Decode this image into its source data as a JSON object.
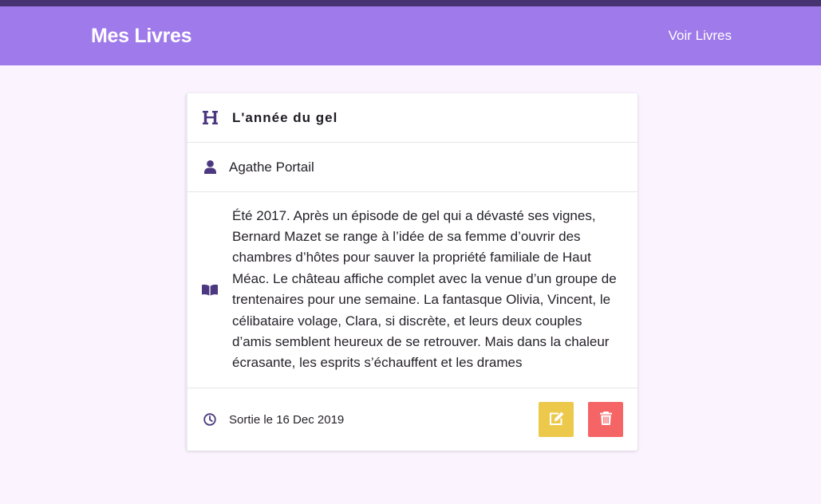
{
  "nav": {
    "brand": "Mes Livres",
    "link": "Voir Livres"
  },
  "book": {
    "title": "L'année du gel",
    "author": "Agathe Portail",
    "description": "Été 2017. Après un épisode de gel qui a dévasté ses vignes, Bernard Mazet se range à l’idée de sa femme d’ouvrir des chambres d’hôtes pour sauver la propriété familiale de Haut Méac. Le château affiche complet avec la venue d’un groupe de trentenaires pour une semaine. La fantasque Olivia, Vincent, le célibataire volage, Clara, si discrète, et leurs deux couples d’amis semblent heureux de se retrouver. Mais dans la chaleur écrasante, les esprits s’échauffent et les drames",
    "release": "Sortie le 16 Dec 2019"
  },
  "icons": {
    "title": "heading-icon",
    "author": "user-icon",
    "description": "book-open-icon",
    "release": "clock-icon",
    "edit": "edit-icon",
    "delete": "trash-icon"
  },
  "colors": {
    "navbar": "#9f7aea",
    "topstrip": "#473272",
    "background": "#fbf4fe",
    "icon": "#4c3880",
    "edit_button": "#ecc94b",
    "delete_button": "#f56565"
  }
}
